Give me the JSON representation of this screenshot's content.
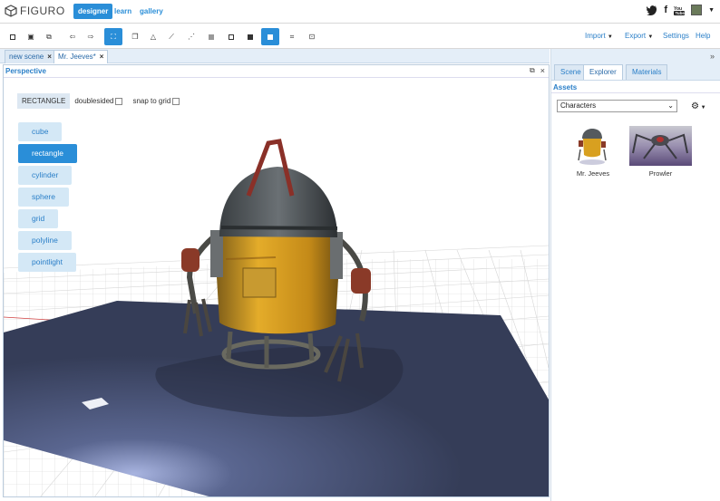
{
  "app": {
    "logo_text": "FIGURO"
  },
  "nav": {
    "items": [
      {
        "label": "designer",
        "active": true
      },
      {
        "label": "learn",
        "active": false
      },
      {
        "label": "gallery",
        "active": false
      }
    ],
    "social": {
      "twitter": "twitter-icon",
      "facebook": "facebook-icon",
      "youtube": "youtube-icon"
    }
  },
  "toolbar": {
    "tools": [
      "new",
      "save",
      "save-as",
      "undo",
      "redo",
      "select",
      "translate",
      "triangle",
      "line",
      "dots",
      "grid-square",
      "square-outline",
      "square-filled",
      "square-filled-active",
      "crop",
      "snapshot"
    ],
    "menus": [
      "Import",
      "Export",
      "Settings",
      "Help"
    ]
  },
  "doc_tabs": [
    {
      "label": "new scene",
      "active": false
    },
    {
      "label": "Mr. Jeeves*",
      "active": true
    }
  ],
  "viewport": {
    "title": "Perspective",
    "shape_label": "RECTANGLE",
    "options": [
      "doublesided",
      "snap to grid"
    ],
    "primitives": [
      {
        "label": "cube",
        "active": false
      },
      {
        "label": "rectangle",
        "active": true
      },
      {
        "label": "cylinder",
        "active": false
      },
      {
        "label": "sphere",
        "active": false
      },
      {
        "label": "grid",
        "active": false
      },
      {
        "label": "polyline",
        "active": false
      },
      {
        "label": "pointlight",
        "active": false
      }
    ]
  },
  "right_panel": {
    "tabs": [
      {
        "label": "Scene",
        "active": false
      },
      {
        "label": "Explorer",
        "active": true
      },
      {
        "label": "Materials",
        "active": false
      }
    ],
    "section_title": "Assets",
    "category": "Characters",
    "assets": [
      {
        "label": "Mr. Jeeves"
      },
      {
        "label": "Prowler"
      }
    ]
  },
  "colors": {
    "accent": "#2a8ed8",
    "button_light": "#d4e8f6",
    "plane": "#3a4560",
    "robot_yellow": "#d8a020"
  }
}
